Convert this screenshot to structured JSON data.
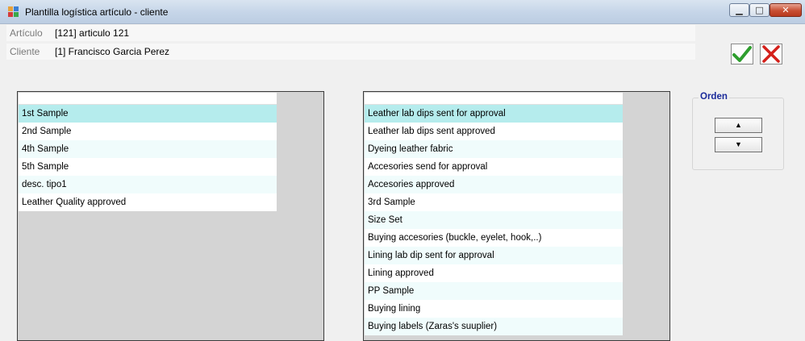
{
  "window": {
    "title": "Plantilla logística artículo - cliente",
    "controls": {
      "minimize": "▁",
      "maximize": "□",
      "close": "✕"
    }
  },
  "header": {
    "articulo": {
      "label": "Artículo",
      "value": "[121] articulo 121"
    },
    "cliente": {
      "label": "Cliente",
      "value": "[1] Francisco Garcia  Perez"
    }
  },
  "actions": {
    "accept_icon": "green-check-icon",
    "cancel_icon": "red-x-icon"
  },
  "left_list": {
    "items": [
      "1st Sample",
      "2nd Sample",
      "4th Sample",
      "5th Sample",
      "desc. tipo1",
      "Leather Quality approved"
    ],
    "selected_index": 0
  },
  "right_list": {
    "items": [
      "Leather lab dips sent for approval",
      "Leather lab dips sent approved",
      "Dyeing leather fabric",
      "Accesories send for approval",
      "Accesories approved",
      "3rd Sample",
      "Size Set",
      "Buying accesories (buckle, eyelet, hook,..)",
      "Lining lab dip sent for approval",
      "Lining approved",
      "PP Sample",
      "Buying lining",
      "Buying labels (Zaras's suuplier)"
    ],
    "selected_index": 0
  },
  "orden": {
    "title": "Orden",
    "up_glyph": "▲",
    "down_glyph": "▼"
  },
  "colors": {
    "selected_row": "#b5eced",
    "alt_row": "#f0fcfc",
    "group_title": "#1a2a9a",
    "check": "#2e9e2e",
    "cross": "#d4201a"
  }
}
